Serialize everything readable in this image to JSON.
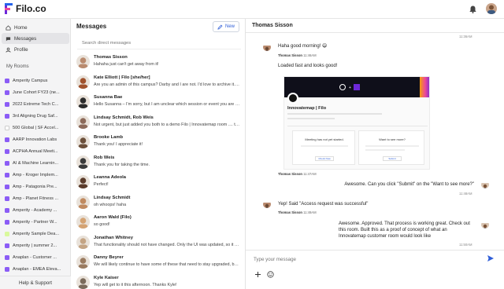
{
  "brand": {
    "name": "Filo.co"
  },
  "sidebar": {
    "nav": [
      {
        "label": "Home",
        "icon": "home-icon"
      },
      {
        "label": "Messages",
        "icon": "chat-bubble-icon"
      },
      {
        "label": "Profile",
        "icon": "user-icon"
      }
    ],
    "rooms_title": "My Rooms",
    "rooms": [
      {
        "label": "Amperity Campus",
        "color": "#8b5cf6"
      },
      {
        "label": "June Cohort FY23 (ne...",
        "color": "#8b5cf6"
      },
      {
        "label": "2022 Extreme Tech C...",
        "color": "#8b5cf6"
      },
      {
        "label": "3rd Aligning Drug Saf...",
        "color": "#8b5cf6"
      },
      {
        "label": "500 Global | SF Accel...",
        "color": "#ffffff"
      },
      {
        "label": "AARP Innovation Labs",
        "color": "#8b5cf6"
      },
      {
        "label": "ACPHA Annual Meeti...",
        "color": "#8b5cf6"
      },
      {
        "label": "AI & Machine Learnin...",
        "color": "#8b5cf6"
      },
      {
        "label": "Amp - Kroger Implem...",
        "color": "#8b5cf6"
      },
      {
        "label": "Amp - Patagonia Pre...",
        "color": "#8b5cf6"
      },
      {
        "label": "Amp - Planet Fitness ...",
        "color": "#8b5cf6"
      },
      {
        "label": "Amperity - Academy ...",
        "color": "#8b5cf6"
      },
      {
        "label": "Amperity - Partner W...",
        "color": "#8b5cf6"
      },
      {
        "label": "Amperity Sample Dea...",
        "color": "#d9f99d"
      },
      {
        "label": "Amperity | summer 2...",
        "color": "#8b5cf6"
      },
      {
        "label": "Anaplan - Customer ...",
        "color": "#8b5cf6"
      },
      {
        "label": "Anaplan - EMEA Eleva...",
        "color": "#8b5cf6"
      },
      {
        "label": "Anaplan AKO FY23",
        "color": "#8b5cf6"
      }
    ],
    "help": "Help & Support"
  },
  "messages": {
    "title": "Messages",
    "new_label": "New",
    "search_placeholder": "Search direct messages",
    "conversations": [
      {
        "name": "Thomas Sisson",
        "preview": "Hahaha just can't get away from it!",
        "avatar": "#b98a6e"
      },
      {
        "name": "Kate Elliott | Filo [she/her]",
        "preview": "Are you an admin of this campus? Darby and I are not. I'd love to archive it. h...",
        "avatar": "#a0522d"
      },
      {
        "name": "Susanna Bae",
        "preview": "Hello Susanna – I'm sorry, but I am unclear which session or event you are ref...",
        "avatar": "#2b2b2b"
      },
      {
        "name": "Lindsay Schmidt, Rob Weis",
        "preview": "Not urgent, but just added you both to a demo Filo | Innovatemap room .... try...",
        "avatar": "#8c6a5a"
      },
      {
        "name": "Brooke Lamb",
        "preview": "Thank you! I appreciate it!",
        "avatar": "#6b4f3a"
      },
      {
        "name": "Rob Weis",
        "preview": "Thank you for taking the time.",
        "avatar": "#3a3a3a"
      },
      {
        "name": "Leanna Adeola",
        "preview": "Perfect!",
        "avatar": "#5a3b2a"
      },
      {
        "name": "Lindsay Schmidt",
        "preview": "oh whoops! haha",
        "avatar": "#c08a60"
      },
      {
        "name": "Aaron Wald (Filo)",
        "preview": "so good!",
        "avatar": "#d4a373"
      },
      {
        "name": "Jonathan Whitney",
        "preview": "That functionality should not have changed. Only the UI was updated, so it sh...",
        "avatar": "#c4a484"
      },
      {
        "name": "Danny Beyrer",
        "preview": "We will likely continue to have some of these that need to stay upgraded, but ...",
        "avatar": "#9a7b60"
      },
      {
        "name": "Kyle Kaiser",
        "preview": "Yep will get to it this afternoon. Thanks Kyle!",
        "avatar": "#7a6a5a"
      }
    ]
  },
  "chat": {
    "title": "Thomas Sisson",
    "items": [
      {
        "kind": "ts-right",
        "text": "11:36AM"
      },
      {
        "kind": "other",
        "text": "Haha good morning! 😄",
        "sender": "Thomas Sisson",
        "time": "11:46AM"
      },
      {
        "kind": "other",
        "text": "Loaded fast and looks good!"
      },
      {
        "kind": "ts-left",
        "sender": "Thomas Sisson",
        "time": "11:47AM"
      },
      {
        "kind": "me",
        "text": "Awesome. Can you click \"Submit\" on the \"Want to see more?\""
      },
      {
        "kind": "ts-right",
        "text": "11:48AM"
      },
      {
        "kind": "other",
        "text": "Yep! Said \"Access request was successful\"",
        "sender": "Thomas Sisson",
        "time": "11:49AM"
      },
      {
        "kind": "me",
        "text": "Awesome. Approved. That process is working great. Check out this room. Built this as a proof of concept of what an Innovatemap customer room would look like"
      },
      {
        "kind": "ts-right",
        "text": "11:50AM"
      }
    ],
    "embed": {
      "room_name": "Innovatemap | Filo",
      "left_card_title": "Meeting has not yet started.",
      "left_button": "Check Now",
      "right_card_title": "Want to see more?",
      "right_button": "Submit"
    },
    "input_placeholder": "Type your message"
  }
}
